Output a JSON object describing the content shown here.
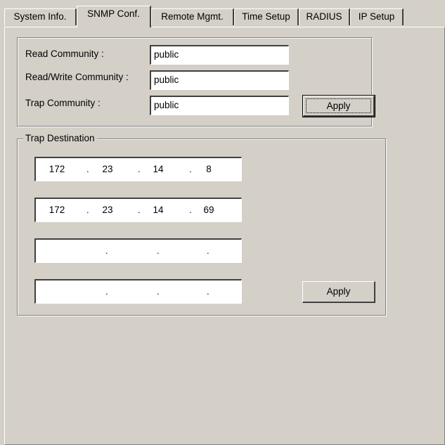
{
  "tabs": [
    {
      "label": "System Info."
    },
    {
      "label": "SNMP Conf."
    },
    {
      "label": "Remote Mgmt."
    },
    {
      "label": "Time Setup"
    },
    {
      "label": "RADIUS"
    },
    {
      "label": "IP Setup"
    }
  ],
  "active_tab": "SNMP Conf.",
  "community": {
    "read_label": "Read Community :",
    "read_value": "public",
    "readwrite_label": "Read/Write Community :",
    "readwrite_value": "public",
    "trap_label": "Trap Community :",
    "trap_value": "public",
    "apply_label": "Apply"
  },
  "trap_destination": {
    "legend": "Trap Destination",
    "addresses": [
      [
        "172",
        "23",
        "14",
        "8"
      ],
      [
        "172",
        "23",
        "14",
        "69"
      ],
      [
        "",
        "",
        "",
        ""
      ],
      [
        "",
        "",
        "",
        ""
      ]
    ],
    "separator": ".",
    "apply_label": "Apply"
  }
}
